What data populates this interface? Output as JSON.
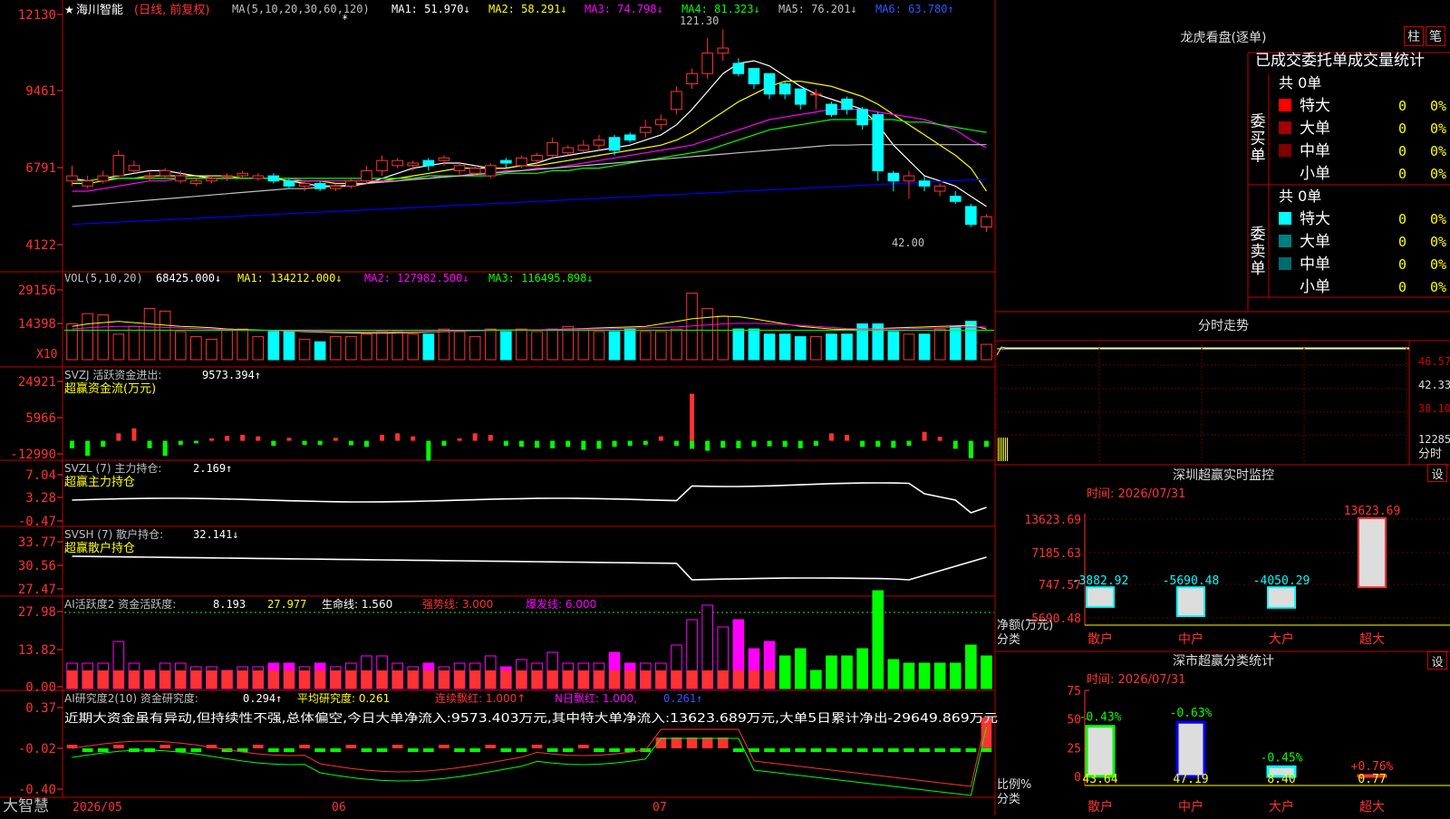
{
  "stock": {
    "star": "★",
    "name": "海川智能",
    "mode": "(日线, 前复权)"
  },
  "colors": {
    "up": "#ff3232",
    "down": "#00ffff",
    "white": "#ffffff",
    "yellow": "#ffff00",
    "magenta": "#ff00ff",
    "green": "#00ff00",
    "gray": "#c0c0c0",
    "blue": "#0000ff",
    "grid": "#c00000",
    "text": "#c0c0c0"
  },
  "main_chart": {
    "header": {
      "ma_label": "MA(5,10,20,30,60,120)",
      "ma1": "MA1: 51.970↓",
      "ma2": "MA2: 58.291↓",
      "ma3": "MA3: 74.798↓",
      "ma4": "MA4: 81.323↓",
      "ma5": "MA5: 76.201↓",
      "ma6": "MA6: 63.780↑"
    },
    "y_ticks": [
      "12130",
      "9461",
      "6791",
      "4122"
    ],
    "high_label": "121.30",
    "low_label": "42.00",
    "star_mark": "*"
  },
  "chart_data": [
    {
      "type": "candlestick",
      "name": "price",
      "n": 60,
      "open": [
        62,
        60,
        62,
        64,
        66,
        64,
        64,
        62,
        61,
        62,
        64,
        64,
        63,
        64,
        62,
        60,
        61,
        59,
        60,
        62,
        66,
        68,
        68,
        70,
        70,
        66,
        65,
        64,
        70,
        68,
        70,
        72,
        73,
        74,
        76,
        79,
        80,
        81,
        84,
        90,
        100,
        104,
        112,
        108,
        106,
        104,
        100,
        98,
        96,
        92,
        94,
        90,
        88,
        65,
        62,
        62,
        58,
        56,
        52,
        44
      ],
      "close": [
        64,
        62,
        64,
        72,
        68,
        64,
        66,
        64,
        62,
        63,
        64,
        65,
        64,
        62,
        60,
        61,
        59,
        60,
        62,
        66,
        70,
        70,
        69,
        68,
        71,
        68,
        67,
        68,
        69,
        71,
        72,
        77,
        75,
        76,
        78,
        74,
        78,
        83,
        86,
        97,
        104,
        112,
        114,
        104,
        100,
        96,
        96,
        92,
        96,
        88,
        90,
        84,
        66,
        62,
        64,
        60,
        60,
        54,
        45,
        48
      ],
      "high": [
        68,
        64,
        66,
        74,
        70,
        66,
        67,
        66,
        63,
        64,
        65,
        66,
        65,
        65,
        63,
        62,
        62,
        61,
        63,
        68,
        72,
        71,
        70,
        71,
        72,
        69,
        68,
        69,
        71,
        72,
        73,
        79,
        76,
        78,
        80,
        80,
        81,
        86,
        88,
        99,
        106,
        118,
        121.3,
        110,
        106,
        104,
        101,
        98,
        98,
        93,
        95,
        91,
        89,
        66,
        66,
        64,
        61,
        58,
        53,
        49
      ],
      "low": [
        60,
        59,
        61,
        63,
        65,
        62,
        63,
        61,
        60,
        61,
        62,
        63,
        62,
        61,
        59,
        58,
        58,
        58,
        59,
        61,
        64,
        67,
        66,
        66,
        68,
        64,
        64,
        63,
        67,
        67,
        68,
        71,
        72,
        73,
        74,
        72,
        77,
        79,
        82,
        88,
        98,
        102,
        109,
        103,
        98,
        94,
        94,
        90,
        90,
        87,
        88,
        82,
        62,
        58,
        55,
        58,
        56,
        53,
        44,
        42
      ],
      "ma5": [
        63,
        62,
        63,
        64,
        65,
        66,
        66,
        65,
        64,
        63,
        63,
        63,
        63,
        63,
        62,
        61,
        60,
        60,
        60,
        61,
        63,
        65,
        67,
        68,
        69,
        69,
        68,
        67,
        67,
        68,
        69,
        71,
        72,
        73,
        74,
        75,
        76,
        78,
        80,
        84,
        90,
        97,
        104,
        108,
        109,
        107,
        103,
        99,
        96,
        94,
        92,
        90,
        84,
        76,
        70,
        64,
        62,
        60,
        56,
        52
      ],
      "ma10": [
        61,
        61,
        62,
        63,
        63,
        64,
        64,
        64,
        64,
        64,
        64,
        63,
        63,
        63,
        62,
        62,
        62,
        61,
        61,
        61,
        62,
        63,
        64,
        65,
        66,
        67,
        67,
        67,
        67,
        68,
        68,
        69,
        70,
        71,
        72,
        73,
        74,
        75,
        76,
        78,
        81,
        85,
        89,
        93,
        96,
        99,
        101,
        101,
        100,
        99,
        97,
        95,
        92,
        88,
        84,
        80,
        76,
        72,
        67,
        58
      ],
      "ma20": [
        58,
        58,
        59,
        60,
        61,
        62,
        62,
        63,
        63,
        63,
        63,
        63,
        63,
        63,
        63,
        62,
        62,
        62,
        62,
        62,
        62,
        62,
        63,
        63,
        64,
        64,
        65,
        65,
        66,
        66,
        67,
        67,
        68,
        69,
        70,
        71,
        72,
        73,
        74,
        75,
        76,
        78,
        80,
        82,
        84,
        86,
        87,
        88,
        89,
        90,
        90,
        90,
        89,
        88,
        87,
        86,
        84,
        82,
        78,
        75
      ],
      "ma30": [
        62,
        62,
        63,
        63,
        63,
        63,
        63,
        63,
        63,
        63,
        63,
        63,
        63,
        63,
        63,
        63,
        63,
        63,
        63,
        63,
        63,
        63,
        63,
        64,
        64,
        64,
        64,
        64,
        65,
        65,
        65,
        66,
        66,
        67,
        67,
        68,
        69,
        70,
        71,
        72,
        73,
        74,
        76,
        78,
        80,
        82,
        83,
        84,
        85,
        86,
        86,
        86,
        86,
        86,
        85,
        85,
        84,
        83,
        82,
        81
      ],
      "ma60": [
        52,
        52.5,
        53,
        53.5,
        54,
        54.5,
        55,
        55.5,
        56,
        56.5,
        57,
        57.5,
        58,
        58.5,
        59,
        59,
        59.5,
        60,
        60.5,
        61,
        61.5,
        62,
        62.5,
        63,
        63.5,
        64,
        64.5,
        65,
        65.5,
        66,
        66.5,
        67,
        67.5,
        68,
        68.5,
        69,
        69.5,
        70,
        70.5,
        71,
        71.5,
        72,
        72.5,
        73,
        73.5,
        74,
        74.5,
        75,
        75.5,
        76,
        76,
        76.2,
        76.2,
        76.2,
        76.2,
        76.2,
        76.2,
        76.2,
        76.2,
        76.2
      ],
      "ma120": [
        45,
        45.3,
        45.6,
        45.9,
        46.2,
        46.5,
        46.8,
        47.1,
        47.4,
        47.7,
        48,
        48.3,
        48.6,
        48.9,
        49.2,
        49.5,
        49.8,
        50.1,
        50.4,
        50.7,
        51,
        51.3,
        51.6,
        51.9,
        52.2,
        52.5,
        52.8,
        53.1,
        53.4,
        53.7,
        54,
        54.3,
        54.6,
        54.9,
        55.2,
        55.5,
        55.8,
        56.1,
        56.4,
        56.7,
        57,
        57.3,
        57.6,
        57.9,
        58.2,
        58.5,
        58.8,
        59.1,
        59.4,
        59.7,
        60,
        60.3,
        60.6,
        60.9,
        61.2,
        61.5,
        61.8,
        62.1,
        62.4,
        62.7
      ]
    },
    {
      "type": "bar",
      "name": "VOL",
      "y_ticks": [
        "29156",
        "14398"
      ],
      "multiplier_label": "X10",
      "header": {
        "label": "VOL(5,10,20)",
        "vol": "68425.000↓",
        "ma1": "MA1: 134212.000↓",
        "ma2": "MA2: 127982.500↓",
        "ma3": "MA3: 116495.898↓"
      },
      "values": [
        140,
        180,
        175,
        100,
        130,
        200,
        190,
        110,
        90,
        80,
        120,
        120,
        90,
        110,
        110,
        80,
        70,
        90,
        90,
        100,
        110,
        110,
        100,
        100,
        120,
        110,
        90,
        120,
        110,
        120,
        110,
        120,
        130,
        120,
        110,
        110,
        120,
        110,
        110,
        120,
        260,
        200,
        170,
        120,
        120,
        100,
        100,
        90,
        90,
        100,
        100,
        140,
        140,
        110,
        100,
        100,
        120,
        130,
        150,
        60
      ],
      "ma": [
        130,
        140,
        145,
        150,
        145,
        140,
        135,
        130,
        128,
        125,
        120,
        118,
        116,
        114,
        112,
        110,
        108,
        106,
        105,
        104,
        104,
        105,
        106,
        108,
        110,
        112,
        114,
        116,
        116,
        116,
        116,
        118,
        120,
        122,
        124,
        126,
        128,
        130,
        140,
        150,
        160,
        165,
        170,
        168,
        160,
        150,
        140,
        130,
        125,
        120,
        118,
        120,
        122,
        124,
        126,
        128,
        130,
        132,
        134,
        120
      ],
      "ma_b": [
        120,
        125,
        128,
        130,
        130,
        128,
        126,
        124,
        122,
        120,
        118,
        116,
        115,
        114,
        113,
        112,
        111,
        110,
        109,
        108,
        108,
        108,
        109,
        110,
        111,
        112,
        113,
        114,
        115,
        116,
        117,
        118,
        119,
        120,
        121,
        122,
        123,
        124,
        126,
        128,
        132,
        136,
        140,
        142,
        142,
        140,
        138,
        134,
        130,
        126,
        122,
        120,
        120,
        121,
        122,
        123,
        124,
        126,
        128,
        128
      ]
    },
    {
      "type": "bar",
      "name": "SVZJ",
      "y_ticks": [
        "24921",
        "5966",
        "-12990"
      ],
      "header": {
        "label": "SVZJ  活跃资金进出:",
        "value": "9573.394↑",
        "subtitle": "超赢资金流(万元)"
      },
      "values": [
        -1500,
        -3000,
        -1200,
        1500,
        2500,
        -1500,
        -3000,
        -800,
        -500,
        500,
        1000,
        1200,
        900,
        -1000,
        600,
        -800,
        -800,
        600,
        -900,
        -1200,
        1200,
        1500,
        900,
        -4000,
        -1000,
        500,
        1500,
        1200,
        -1000,
        -1200,
        -1400,
        -1500,
        -1200,
        -1800,
        -1600,
        -1200,
        -1000,
        -800,
        900,
        -1000,
        -1600,
        -2000,
        -1400,
        -1500,
        -1200,
        -1100,
        -1200,
        -1500,
        -1000,
        1500,
        1200,
        -1200,
        -1200,
        -1400,
        -1000,
        1800,
        800,
        -1600,
        -3500,
        -1200
      ]
    },
    {
      "type": "line",
      "name": "SVZL",
      "y_ticks": [
        "7.04",
        "3.28",
        "-0.47"
      ],
      "header": {
        "label": "SVZL (7) 主力持仓:",
        "value": "2.169↑",
        "subtitle": "超赢主力持仓"
      }
    },
    {
      "type": "line",
      "name": "SVSH",
      "y_ticks": [
        "33.77",
        "30.56",
        "27.47"
      ],
      "header": {
        "label": "SVSH (7) 散户持仓:",
        "value": "32.141↓",
        "subtitle": "超赢散户持仓"
      }
    },
    {
      "type": "bar",
      "name": "AI活跃度2",
      "y_ticks": [
        "27.98",
        "13.82",
        "0.00"
      ],
      "header": {
        "label": "AI活跃度2 资金活跃度:",
        "value": "8.193",
        "v2": "27.977",
        "life": "生命线: 1.560",
        "strong": "强势线: 3.000",
        "burst": "爆发线: 6.000"
      }
    },
    {
      "type": "bar",
      "name": "AI研究度2",
      "y_ticks": [
        "0.37",
        "-0.02",
        "-0.40"
      ],
      "header": {
        "label": "AI研究度2(10) 资金研究度:",
        "value": "0.294↑",
        "avg": "平均研究度: 0.261",
        "streak": "连续飘红: 1.000↑",
        "nday": "N日飘红: 1.000,",
        "tail": "0.261↑"
      },
      "comment": "近期大资金虽有异动,但持续性不强,总体偏空,今日大单净流入:9573.403万元,其中特大单净流入:13623.689万元,大单5日累计净出-29649.869万元"
    }
  ],
  "x_axis": {
    "labels": [
      "2026/05",
      "06",
      "07"
    ]
  },
  "logo": "大智慧",
  "right_panel": {
    "lhb": {
      "title": "龙虎看盘(逐单)",
      "btn1": "柱",
      "btn2": "笔",
      "subtitle": "已成交委托单成交量统计",
      "buy": {
        "side": "委买单",
        "total": "共 0单",
        "rows": [
          {
            "label": "特大",
            "count": "0",
            "pct": "0%",
            "color": "#ff0000"
          },
          {
            "label": "大单",
            "count": "0",
            "pct": "0%",
            "color": "#a00000"
          },
          {
            "label": "中单",
            "count": "0",
            "pct": "0%",
            "color": "#800000"
          },
          {
            "label": "小单",
            "count": "0",
            "pct": "0%",
            "color": "#000000"
          }
        ]
      },
      "sell": {
        "side": "委卖单",
        "total": "共 0单",
        "rows": [
          {
            "label": "特大",
            "count": "0",
            "pct": "0%",
            "color": "#00ffff"
          },
          {
            "label": "大单",
            "count": "0",
            "pct": "0%",
            "color": "#008080"
          },
          {
            "label": "中单",
            "count": "0",
            "pct": "0%",
            "color": "#006b6b"
          },
          {
            "label": "小单",
            "count": "0",
            "pct": "0%",
            "color": "#000000"
          }
        ]
      }
    },
    "intraday": {
      "title": "分时走势",
      "labels": [
        "46.57",
        "42.33",
        "38.10",
        "12285",
        "分时"
      ]
    },
    "sz_monitor": {
      "title": "深圳超赢实时监控",
      "set": "设",
      "time": "时间: 2026/07/31",
      "y_ticks": [
        "13623.69",
        "7185.63",
        "747.57",
        "-5690.48"
      ],
      "axis_label": "净额(万元)",
      "cat_label": "分类",
      "categories": [
        "散户",
        "中户",
        "大户",
        "超大"
      ],
      "values": [
        -3882.92,
        -5690.48,
        -4050.29,
        13623.69
      ],
      "value_labels": [
        "-3882.92",
        "-5690.48",
        "-4050.29",
        "13623.69"
      ]
    },
    "sz_stats": {
      "title": "深市超赢分类统计",
      "set": "设",
      "time": "时间: 2026/07/31",
      "y_ticks": [
        "75",
        "50",
        "25",
        "0"
      ],
      "axis_label": "比例%",
      "cat_label": "分类",
      "categories": [
        "散户",
        "中户",
        "大户",
        "超大"
      ],
      "values": [
        43.64,
        47.19,
        8.4,
        0.77
      ],
      "value_labels": [
        "43.64",
        "47.19",
        "8.40",
        "0.77"
      ],
      "changes": [
        "-0.43%",
        "-0.63%",
        "-0.45%",
        "+0.76%"
      ]
    }
  }
}
